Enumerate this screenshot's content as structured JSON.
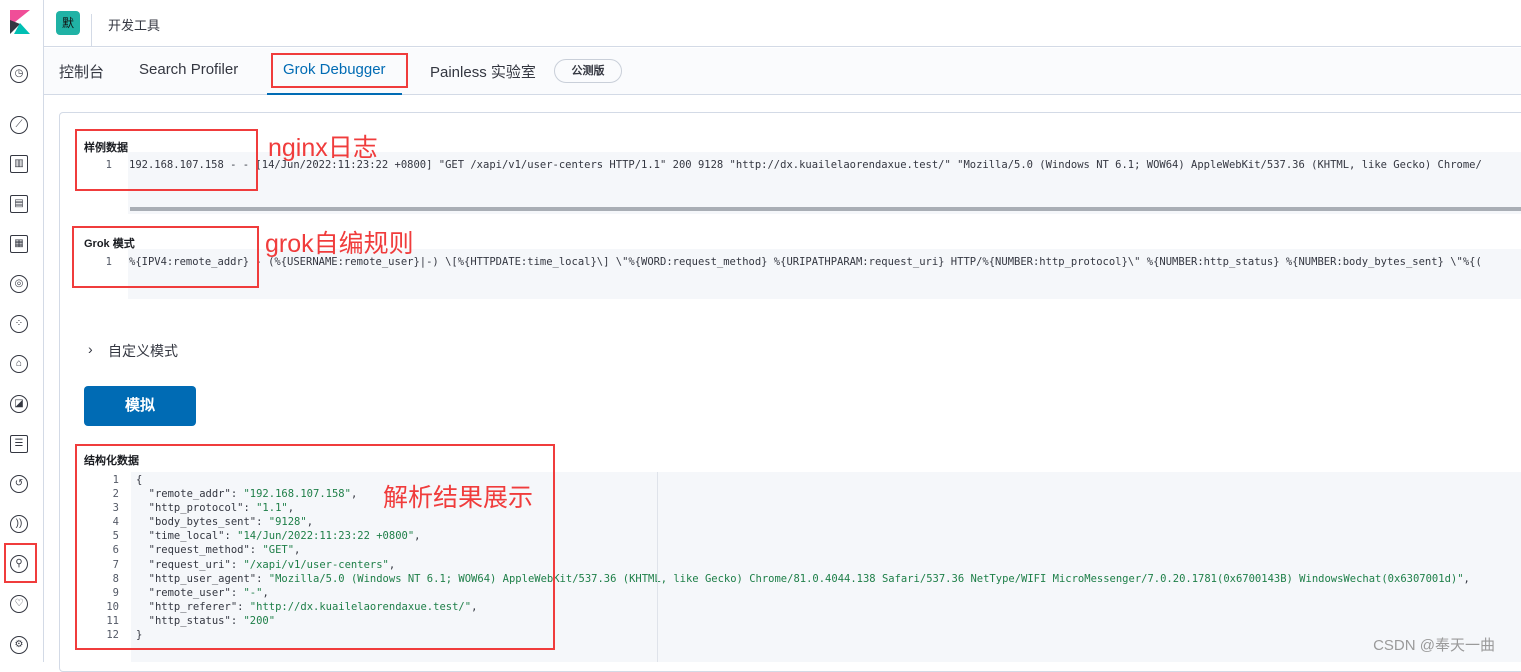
{
  "header": {
    "space_avatar": "默",
    "breadcrumb": "开发工具"
  },
  "tabs": [
    {
      "label": "控制台"
    },
    {
      "label": "Search Profiler"
    },
    {
      "label": "Grok Debugger",
      "active": true
    },
    {
      "label": "Painless 实验室"
    }
  ],
  "beta_badge": "公测版",
  "sample": {
    "label": "样例数据",
    "line_no": "1",
    "text": "192.168.107.158 - - [14/Jun/2022:11:23:22 +0800] \"GET /xapi/v1/user-centers HTTP/1.1\" 200 9128 \"http://dx.kuailelaorendaxue.test/\" \"Mozilla/5.0 (Windows NT 6.1; WOW64) AppleWebKit/537.36 (KHTML, like Gecko) Chrome/"
  },
  "grok": {
    "label": "Grok 模式",
    "line_no": "1",
    "text": "%{IPV4:remote_addr} - (%{USERNAME:remote_user}|-) \\[%{HTTPDATE:time_local}\\] \\\"%{WORD:request_method} %{URIPATHPARAM:request_uri} HTTP/%{NUMBER:http_protocol}\\\" %{NUMBER:http_status} %{NUMBER:body_bytes_sent} \\\"%{("
  },
  "custom_patterns": {
    "label": "自定义模式"
  },
  "simulate_button": "模拟",
  "structured": {
    "label": "结构化数据",
    "lines": [
      {
        "no": "1",
        "text": "{"
      },
      {
        "no": "2",
        "text": "  \"remote_addr\": \"192.168.107.158\","
      },
      {
        "no": "3",
        "text": "  \"http_protocol\": \"1.1\","
      },
      {
        "no": "4",
        "text": "  \"body_bytes_sent\": \"9128\","
      },
      {
        "no": "5",
        "text": "  \"time_local\": \"14/Jun/2022:11:23:22 +0800\","
      },
      {
        "no": "6",
        "text": "  \"request_method\": \"GET\","
      },
      {
        "no": "7",
        "text": "  \"request_uri\": \"/xapi/v1/user-centers\","
      },
      {
        "no": "8",
        "text": "  \"http_user_agent\": \"Mozilla/5.0 (Windows NT 6.1; WOW64) AppleWebKit/537.36 (KHTML, like Gecko) Chrome/81.0.4044.138 Safari/537.36 NetType/WIFI MicroMessenger/7.0.20.1781(0x6700143B) WindowsWechat(0x6307001d)\","
      },
      {
        "no": "9",
        "text": "  \"remote_user\": \"-\","
      },
      {
        "no": "10",
        "text": "  \"http_referer\": \"http://dx.kuailelaorendaxue.test/\","
      },
      {
        "no": "11",
        "text": "  \"http_status\": \"200\""
      },
      {
        "no": "12",
        "text": "}"
      }
    ]
  },
  "annotations": {
    "sample": "nginx日志",
    "grok": "grok自编规则",
    "result": "解析结果展示"
  },
  "watermark": "CSDN @奉天一曲",
  "colors": {
    "accent": "#006bb4",
    "annotation": "#f03c3c"
  }
}
